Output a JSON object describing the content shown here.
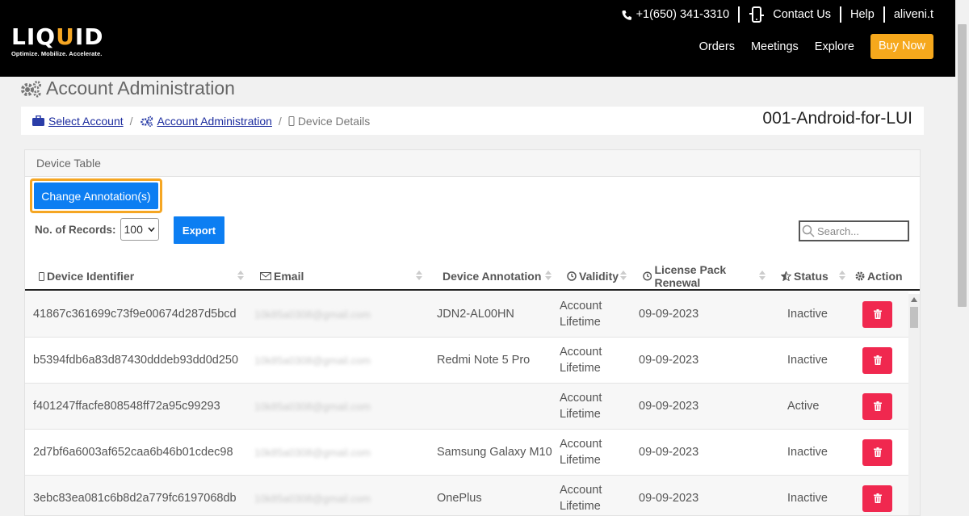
{
  "header": {
    "logo": {
      "prefix": "LIQ",
      "accent": "U",
      "suffix": "ID",
      "tagline": "Optimize. Mobilize. Accelerate."
    },
    "phone": "+1(650) 341-3310",
    "contact": "Contact Us",
    "help": "Help",
    "user": "aliveni.t",
    "nav": [
      "Orders",
      "Meetings",
      "Explore"
    ],
    "buy": "Buy Now"
  },
  "page_title": "Account Administration",
  "breadcrumb": {
    "select_account": "Select Account",
    "account_admin": "Account Administration",
    "current": "Device Details",
    "account_name": "001-Android-for-LUI"
  },
  "panel": {
    "title": "Device Table",
    "change_annotations": "Change Annotation(s)",
    "records_label": "No. of Records:",
    "records_value": "100",
    "export": "Export",
    "search_placeholder": "Search..."
  },
  "table": {
    "columns": [
      "Device Identifier",
      "Email",
      "Device Annotation",
      "Validity",
      "License Pack Renewal",
      "Status",
      "Action"
    ],
    "rows": [
      {
        "id": "41867c361699c73f9e00674d287d5bcd",
        "email": "10k85a0308@gmail.com",
        "annotation": "JDN2-AL00HN",
        "validity1": "Account",
        "validity2": "Lifetime",
        "renewal": "09-09-2023",
        "status": "Inactive"
      },
      {
        "id": "b5394fdb6a83d87430dddeb93dd0d250",
        "email": "10k85a0308@gmail.com",
        "annotation": "Redmi Note 5 Pro",
        "validity1": "Account",
        "validity2": "Lifetime",
        "renewal": "09-09-2023",
        "status": "Inactive"
      },
      {
        "id": "f401247ffacfe808548ff72a95c99293",
        "email": "10k85a0308@gmail.com",
        "annotation": "",
        "validity1": "Account",
        "validity2": "Lifetime",
        "renewal": "09-09-2023",
        "status": "Active"
      },
      {
        "id": "2d7bf6a6003af652caa6b46b01cdec98",
        "email": "10k85a0308@gmail.com",
        "annotation": "Samsung Galaxy M10",
        "validity1": "Account",
        "validity2": "Lifetime",
        "renewal": "09-09-2023",
        "status": "Inactive"
      },
      {
        "id": "3ebc83ea081c6b8d2a779fc6197068db",
        "email": "10k85a0308@gmail.com",
        "annotation": "OnePlus",
        "validity1": "Account",
        "validity2": "Lifetime",
        "renewal": "09-09-2023",
        "status": "Inactive"
      }
    ]
  },
  "colors": {
    "accent": "#f6a81c",
    "primary": "#0c7ef2",
    "danger": "#f0284f",
    "link": "#1b2b9e"
  }
}
